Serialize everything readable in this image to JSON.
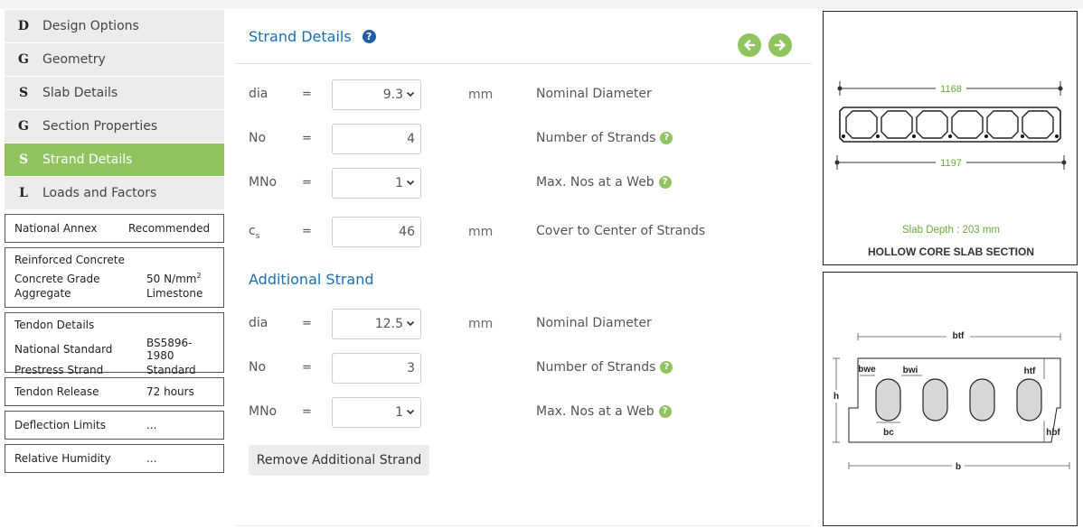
{
  "sidebar": {
    "items": [
      {
        "letter": "D",
        "label": "Design Options",
        "active": false
      },
      {
        "letter": "G",
        "label": "Geometry",
        "active": false
      },
      {
        "letter": "S",
        "label": "Slab Details",
        "active": false
      },
      {
        "letter": "G",
        "label": "Section Properties",
        "active": false
      },
      {
        "letter": "S",
        "label": "Strand Details",
        "active": true
      },
      {
        "letter": "L",
        "label": "Loads and Factors",
        "active": false
      }
    ],
    "national_annex": {
      "label": "National Annex",
      "value": "Recommended"
    },
    "reinforced_concrete": {
      "title": "Reinforced Concrete",
      "grade_label": "Concrete Grade",
      "grade_value": "50 N/mm",
      "grade_sup": "2",
      "aggregate_label": "Aggregate",
      "aggregate_value": "Limestone"
    },
    "tendon_details": {
      "title": "Tendon Details",
      "standard_label": "National Standard",
      "standard_value": "BS5896-1980",
      "prestress_label": "Prestress Strand",
      "prestress_value": "Standard"
    },
    "tendon_release": {
      "label": "Tendon Release",
      "value": "72 hours"
    },
    "deflection_limits": {
      "label": "Deflection Limits",
      "value": "..."
    },
    "relative_humidity": {
      "label": "Relative Humidity",
      "value": "..."
    }
  },
  "main": {
    "title": "Strand Details",
    "help_icon": "question-circle-icon",
    "prev_icon": "arrow-left-circle-icon",
    "next_icon": "arrow-right-circle-icon",
    "strand_rows": [
      {
        "symbol": "dia",
        "eq": "=",
        "value": "9.3",
        "type": "select",
        "unit": "mm",
        "desc": "Nominal Diameter",
        "help": false
      },
      {
        "symbol": "No",
        "eq": "=",
        "value": "4",
        "type": "input",
        "unit": "",
        "desc": "Number of Strands",
        "help": true
      },
      {
        "symbol": "MNo",
        "eq": "=",
        "value": "1",
        "type": "select",
        "unit": "",
        "desc": "Max. Nos at a Web",
        "help": true
      },
      {
        "symbol": "c",
        "symbol_sub": "s",
        "eq": "=",
        "value": "46",
        "type": "input",
        "unit": "mm",
        "desc": "Cover to Center of Strands",
        "help": false
      }
    ],
    "additional_title": "Additional Strand",
    "additional_rows": [
      {
        "symbol": "dia",
        "eq": "=",
        "value": "12.5",
        "type": "select",
        "unit": "mm",
        "desc": "Nominal Diameter",
        "help": false
      },
      {
        "symbol": "No",
        "eq": "=",
        "value": "3",
        "type": "input",
        "unit": "",
        "desc": "Number of Strands",
        "help": true
      },
      {
        "symbol": "MNo",
        "eq": "=",
        "value": "1",
        "type": "select",
        "unit": "",
        "desc": "Max. Nos at a Web",
        "help": true
      }
    ],
    "remove_button": "Remove Additional Strand"
  },
  "section_panel": {
    "top_width": "1168",
    "bottom_width": "1197",
    "depth_text": "Slab Depth : 203 mm",
    "caption": "HOLLOW CORE SLAB SECTION",
    "accent_color": "#6aaa3a"
  },
  "legend_panel": {
    "labels": {
      "btf": "btf",
      "bwe": "bwe",
      "bwi": "bwi",
      "htf": "htf",
      "h": "h",
      "bc": "bc",
      "hbf": "hbf",
      "b": "b"
    }
  },
  "colors": {
    "accent_green": "#8fc45f",
    "link_blue": "#1a6fb5"
  }
}
